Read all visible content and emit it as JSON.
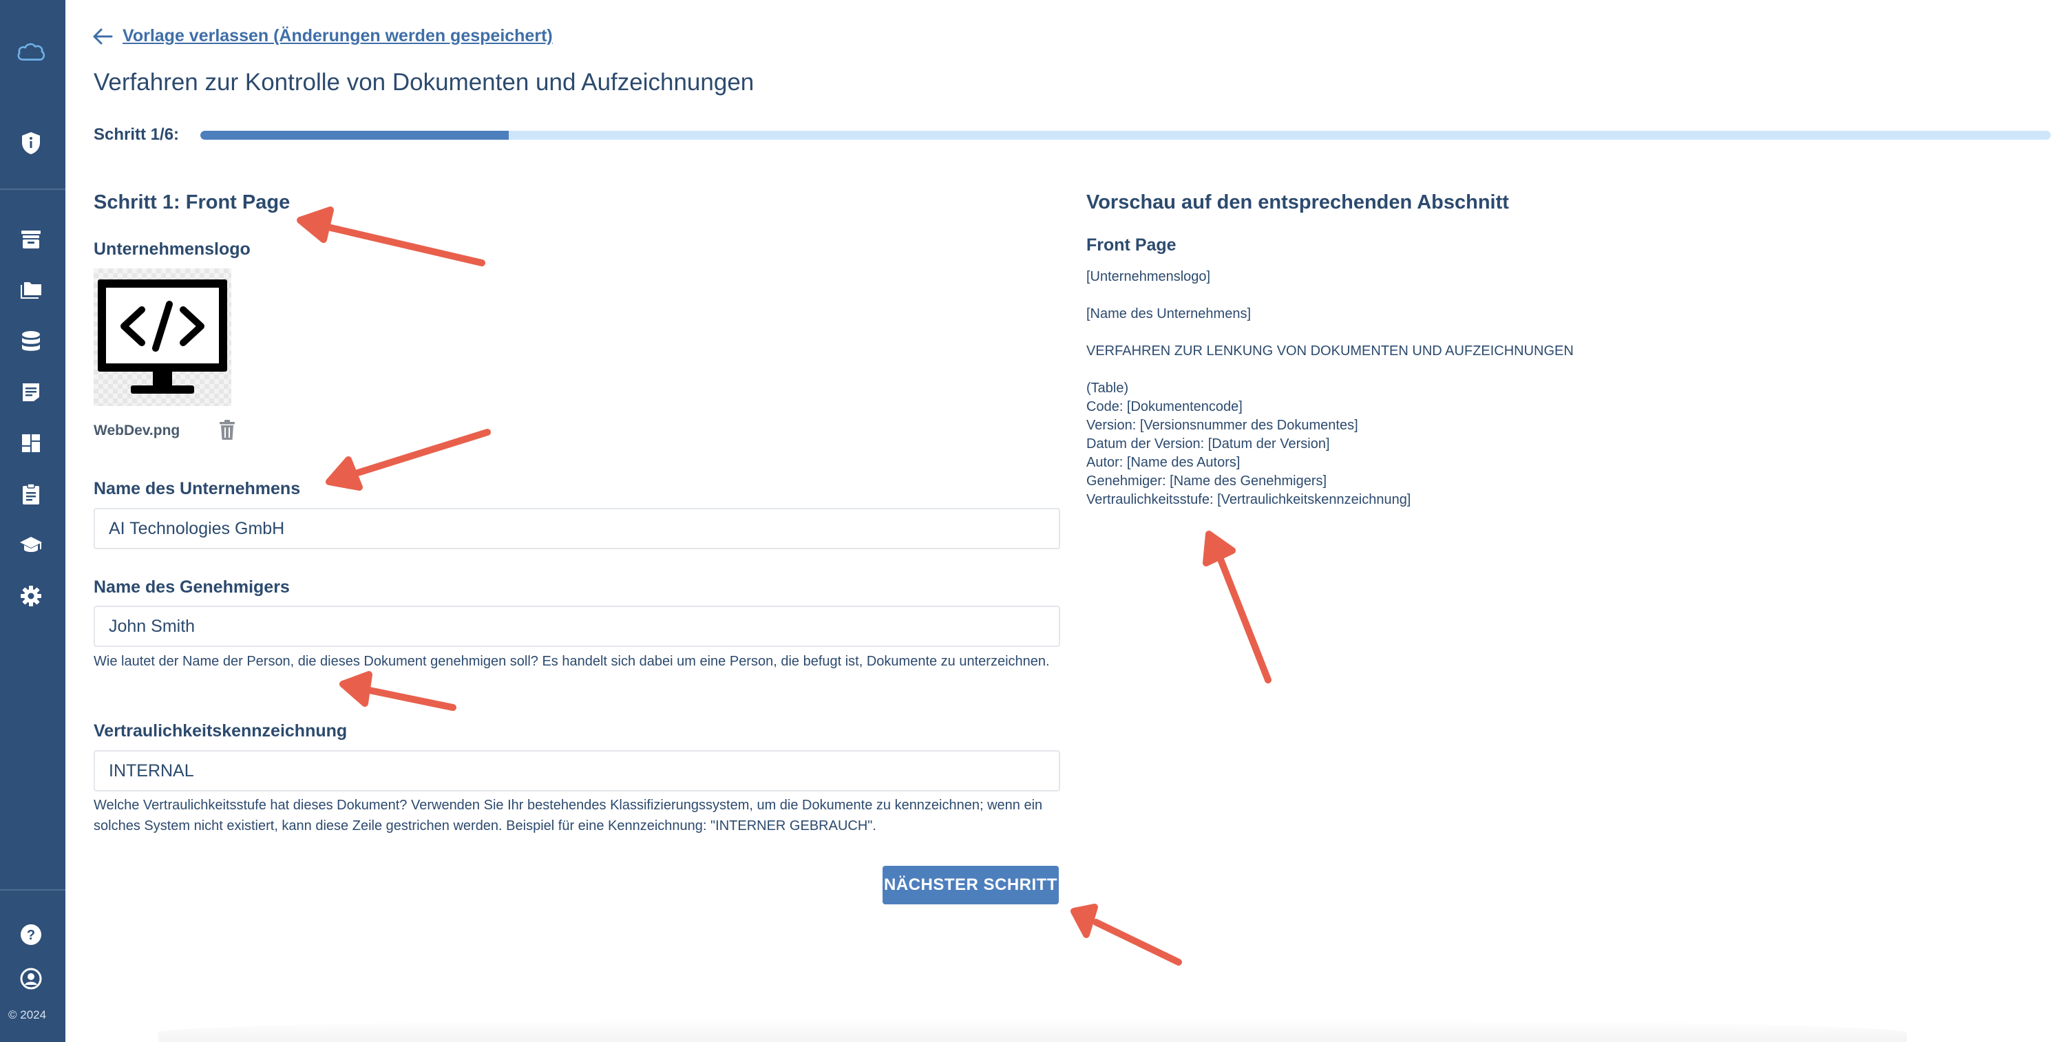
{
  "sidebar": {
    "top_icons": [
      "cloud-logo-icon",
      "shield-icon"
    ],
    "nav_icons": [
      "archive-icon",
      "folders-icon",
      "database-icon",
      "notes-icon",
      "dashboard-icon",
      "clipboard-icon",
      "graduation-cap-icon",
      "gear-icon"
    ],
    "bottom_icons": [
      "help-icon",
      "account-icon"
    ],
    "copyright": "© 2024"
  },
  "header": {
    "back_link": "Vorlage verlassen (Änderungen werden gespeichert)",
    "title": "Verfahren zur Kontrolle von Dokumenten und Aufzeichnungen"
  },
  "progress": {
    "label": "Schritt 1/6:",
    "current": 1,
    "total": 6
  },
  "form": {
    "section_title": "Schritt 1: Front Page",
    "logo_label": "Unternehmenslogo",
    "logo_file": "WebDev.png",
    "company": {
      "label": "Name des Unternehmens",
      "value": "AI Technologies GmbH"
    },
    "approver": {
      "label": "Name des Genehmigers",
      "value": "John Smith",
      "help": "Wie lautet der Name der Person, die dieses Dokument genehmigen soll? Es handelt sich dabei um eine Person, die befugt ist, Dokumente zu unterzeichnen."
    },
    "confidentiality": {
      "label": "Vertraulichkeitskennzeichnung",
      "value": "INTERNAL",
      "help": "Welche Vertraulichkeitsstufe hat dieses Dokument? Verwenden Sie Ihr bestehendes Klassifizierungssystem, um die Dokumente zu kennzeichnen; wenn ein solches System nicht existiert, kann diese Zeile gestrichen werden. Beispiel für eine Kennzeichnung: \"INTERNER GEBRAUCH\"."
    },
    "next_button": "NÄCHSTER SCHRITT"
  },
  "preview": {
    "title": "Vorschau auf den entsprechenden Abschnitt",
    "subtitle": "Front Page",
    "lines": [
      "[Unternehmenslogo]",
      "[Name des Unternehmens]",
      "VERFAHREN ZUR LENKUNG VON DOKUMENTEN UND AUFZEICHNUNGEN",
      "(Table)",
      "Code: [Dokumentencode]",
      "Version: [Versionsnummer des Dokumentes]",
      "Datum der Version: [Datum der Version]",
      "Autor: [Name des Autors]",
      "Genehmiger: [Name des Genehmigers]",
      "Vertraulichkeitsstufe: [Vertraulichkeitskennzeichnung]"
    ]
  },
  "colors": {
    "sidebar": "#2f5079",
    "accent": "#4d7fbd",
    "progress_track": "#cfe6fa",
    "text": "#2c4a6e",
    "annotation_arrow": "#e8604c"
  }
}
